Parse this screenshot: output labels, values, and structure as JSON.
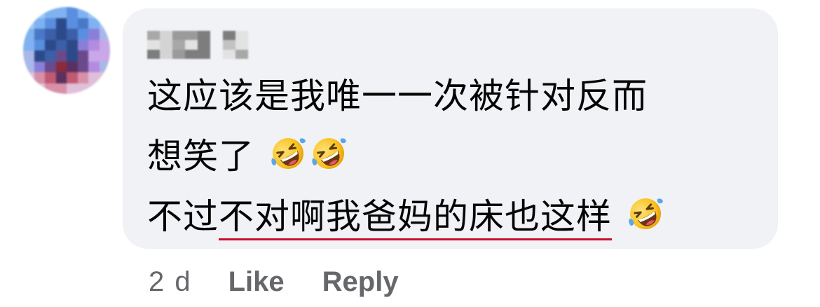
{
  "comment": {
    "text_line1": "这应该是我唯一一次被针对反而",
    "text_line2": "想笑了",
    "text_line3_plain": "不过",
    "text_line3_underlined": "不对啊我爸妈的床也这样",
    "emoji_icon": "rolling-on-floor-laughing-icon",
    "underline_color": "#c8102e"
  },
  "actions": {
    "time": "2 d",
    "like_label": "Like",
    "reply_label": "Reply"
  },
  "colors": {
    "bubble": "#f0f2f5",
    "text": "#050505",
    "meta": "#65676b"
  }
}
